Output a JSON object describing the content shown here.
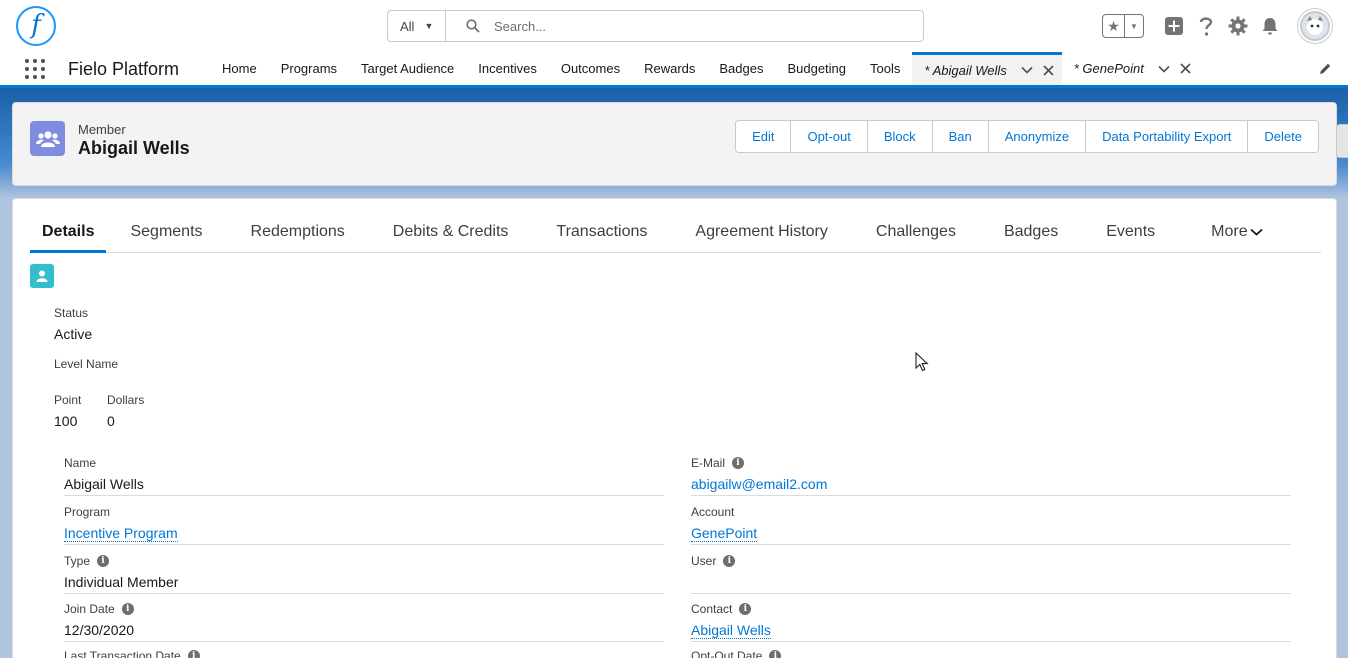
{
  "header": {
    "logo_letter": "f",
    "search_scope": "All",
    "search_placeholder": "Search...",
    "icons": [
      "favorites-star-icon",
      "add-icon",
      "help-icon",
      "setup-gear-icon",
      "notifications-bell-icon",
      "user-avatar"
    ]
  },
  "nav": {
    "app_name": "Fielo Platform",
    "items": [
      "Home",
      "Programs",
      "Target Audience",
      "Incentives",
      "Outcomes",
      "Rewards",
      "Badges",
      "Budgeting",
      "Tools"
    ],
    "tabs": [
      {
        "label": "* Abigail Wells",
        "active": true
      },
      {
        "label": "* GenePoint",
        "active": false
      }
    ]
  },
  "record": {
    "type": "Member",
    "name": "Abigail Wells",
    "actions": [
      "Edit",
      "Opt-out",
      "Block",
      "Ban",
      "Anonymize",
      "Data Portability Export",
      "Delete"
    ]
  },
  "tabs": {
    "items": [
      "Details",
      "Segments",
      "Redemptions",
      "Debits & Credits",
      "Transactions",
      "Agreement History",
      "Challenges",
      "Badges",
      "Events"
    ],
    "more_label": "More",
    "active": "Details"
  },
  "summary": {
    "status_label": "Status",
    "status_value": "Active",
    "level_label": "Level Name",
    "point_label": "Point",
    "point_value": "100",
    "dollars_label": "Dollars",
    "dollars_value": "0"
  },
  "fields": {
    "left": [
      {
        "label": "Name",
        "value": "Abigail Wells"
      },
      {
        "label": "Program",
        "value": "Incentive Program"
      },
      {
        "label": "Type",
        "value": "Individual Member"
      },
      {
        "label": "Join Date",
        "value": "12/30/2020"
      },
      {
        "label": "Last Transaction Date",
        "value": ""
      }
    ],
    "right": [
      {
        "label": "E-Mail",
        "value": "abigailw@email2.com"
      },
      {
        "label": "Account",
        "value": "GenePoint"
      },
      {
        "label": "User",
        "value": ""
      },
      {
        "label": "Contact",
        "value": "Abigail Wells"
      },
      {
        "label": "Opt-Out Date",
        "value": ""
      }
    ]
  },
  "colors": {
    "brand": "#0176d3",
    "member_icon": "#7f8de1",
    "record_icon": "#34becd"
  }
}
